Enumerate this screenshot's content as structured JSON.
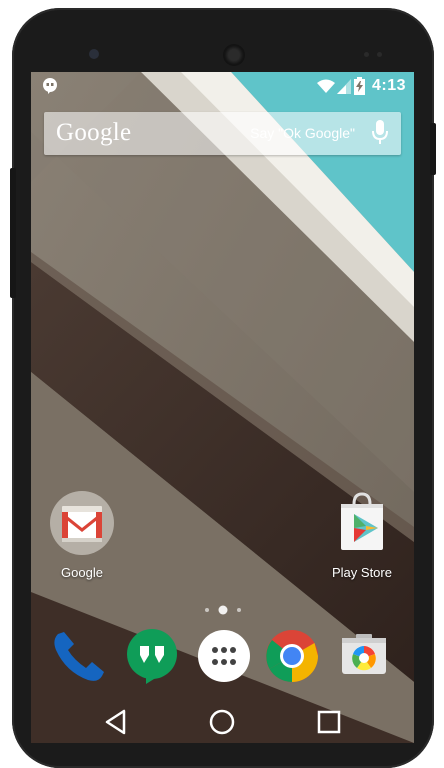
{
  "status_bar": {
    "time": "4:13",
    "icons": [
      "hangouts-notification-icon",
      "wifi-icon",
      "cell-signal-icon",
      "battery-charging-icon"
    ]
  },
  "search_bar": {
    "logo": "Google",
    "hint": "Say \"Ok Google\"",
    "icon": "mic-icon"
  },
  "home_apps": [
    {
      "label": "Google",
      "icon": "gmail-folder-icon"
    },
    {
      "label": "Play Store",
      "icon": "play-store-icon"
    }
  ],
  "page_indicator": {
    "pages": 3,
    "current": 2
  },
  "dock": [
    {
      "icon": "phone-icon"
    },
    {
      "icon": "hangouts-icon"
    },
    {
      "icon": "app-drawer-icon"
    },
    {
      "icon": "chrome-icon"
    },
    {
      "icon": "camera-icon"
    }
  ],
  "nav_bar": [
    "back-icon",
    "home-icon",
    "recents-icon"
  ],
  "colors": {
    "accent_teal": "#5fc4c9",
    "wallpaper_taupe": "#7d7468",
    "wallpaper_dark": "#3a2a24",
    "gmail_red": "#db4437",
    "hangouts_green": "#0f9d58",
    "phone_blue": "#1565c0"
  }
}
